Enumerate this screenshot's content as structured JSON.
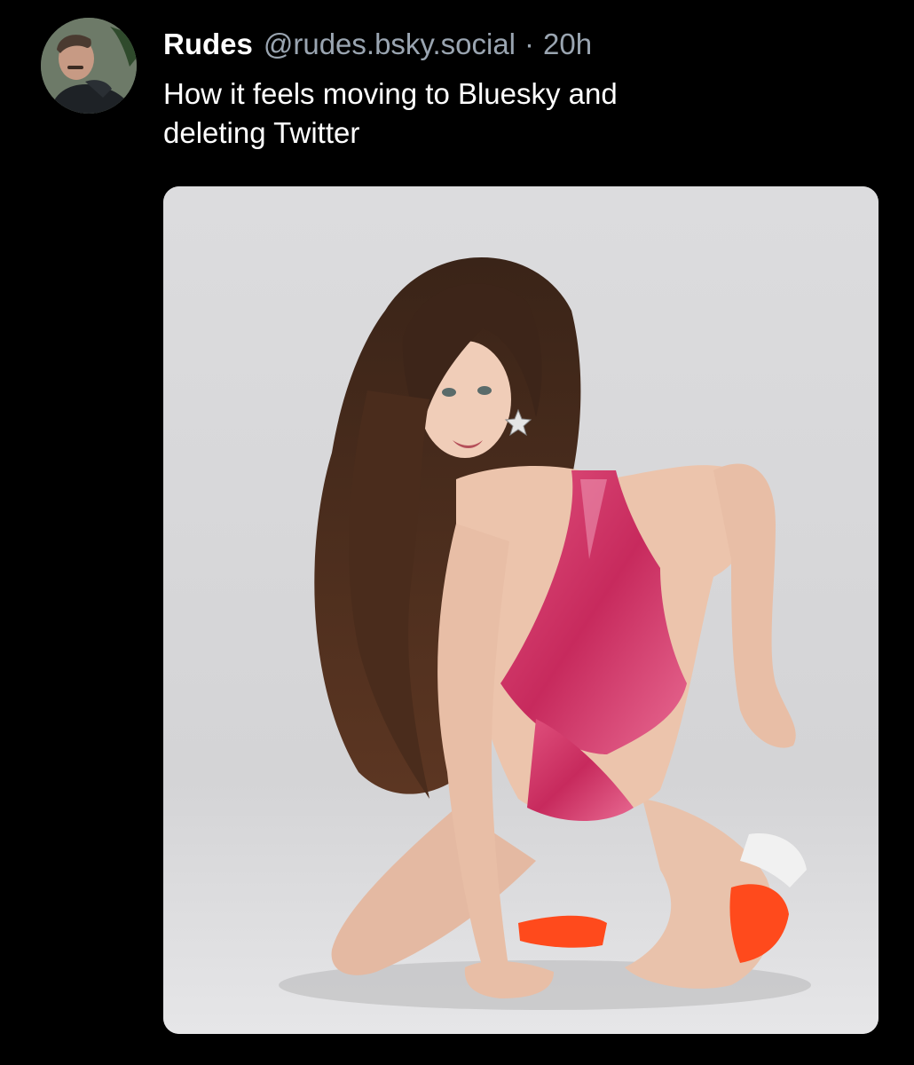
{
  "post": {
    "author": {
      "display_name": "Rudes",
      "handle": "@rudes.bsky.social",
      "avatar_icon": "user-avatar"
    },
    "separator": "·",
    "timestamp": "20h",
    "text_lines": [
      "How it feels moving to Bluesky and",
      "deleting Twitter"
    ],
    "media": {
      "kind": "photo",
      "icon": "photo-woman-pink-swimsuit"
    }
  },
  "theme": {
    "background": "#000000",
    "text_primary": "#ffffff",
    "text_secondary": "#9aa5b1",
    "media_backdrop": "#d6d6d8",
    "swimsuit_pink": "#d6336c",
    "sneaker_orange": "#ff4a1c"
  }
}
